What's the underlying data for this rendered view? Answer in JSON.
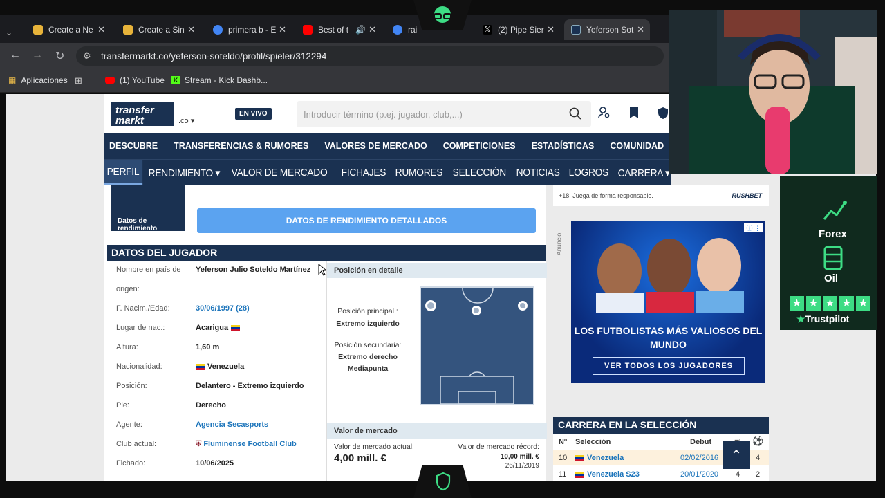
{
  "browser": {
    "tabs": [
      {
        "label": "Create a Ne",
        "fav": "#e7b33a"
      },
      {
        "label": "Create a Sin",
        "fav": "#e7b33a"
      },
      {
        "label": "primera b - E",
        "fav": "#4285f4"
      },
      {
        "label": "Best of t",
        "fav": "#ff0000"
      },
      {
        "label": "rai",
        "fav": "#4285f4"
      },
      {
        "label": "(2) Pipe Sier",
        "fav": "#000000"
      },
      {
        "label": "Yeferson Sot",
        "fav": "#1a3151"
      }
    ],
    "url": "transfermarkt.co/yeferson-soteldo/profil/spieler/312294",
    "bookmarks": [
      "Aplicaciones",
      "(1) YouTube",
      "Stream - Kick Dashb..."
    ]
  },
  "site": {
    "logo": "transfer markt",
    "logo_suffix": ".co",
    "live_badge": "EN VIVO",
    "search_placeholder": "Introducir término (p.ej. jugador, club,...)"
  },
  "main_nav": [
    "DESCUBRE",
    "TRANSFERENCIAS & RUMORES",
    "VALORES DE MERCADO",
    "COMPETICIONES",
    "ESTADÍSTICAS",
    "COMUNIDAD"
  ],
  "sub_nav": [
    "PERFIL",
    "RENDIMIENTO ▾",
    "VALOR DE MERCADO",
    "FICHAJES",
    "RUMORES",
    "SELECCIÓN",
    "NOTICIAS",
    "LOGROS",
    "CARRERA ▾"
  ],
  "performance": {
    "box_label": "Datos de rendimiento",
    "button": "DATOS DE RENDIMIENTO DETALLADOS"
  },
  "player": {
    "section_title": "DATOS DEL JUGADOR",
    "rows": [
      {
        "label": "Nombre en país de",
        "value": "Yeferson Julio Soteldo Martínez",
        "link": false,
        "flag": false
      },
      {
        "label": "origen:",
        "value": "",
        "link": false,
        "flag": false
      },
      {
        "label": "F. Nacim./Edad:",
        "value": "30/06/1997 (28)",
        "link": true,
        "flag": false
      },
      {
        "label": "Lugar de nac.:",
        "value": "Acarigua",
        "link": false,
        "flag": "after"
      },
      {
        "label": "Altura:",
        "value": "1,60 m",
        "link": false,
        "flag": false
      },
      {
        "label": "Nacionalidad:",
        "value": "Venezuela",
        "link": false,
        "flag": "before"
      },
      {
        "label": "Posición:",
        "value": "Delantero - Extremo izquierdo",
        "link": false,
        "flag": false
      },
      {
        "label": "Pie:",
        "value": "Derecho",
        "link": false,
        "flag": false
      },
      {
        "label": "Agente:",
        "value": "Agencia Secasports",
        "link": true,
        "flag": false
      },
      {
        "label": "Club actual:",
        "value": "Fluminense Football Club",
        "link": true,
        "flag": false
      },
      {
        "label": "Fichado:",
        "value": "10/06/2025",
        "link": false,
        "flag": false
      }
    ]
  },
  "position": {
    "title": "Posición en detalle",
    "main_label": "Posición principal :",
    "main_value": "Extremo izquierdo",
    "secondary_label": "Posición secundaria:",
    "secondary_values": [
      "Extremo derecho",
      "Mediapunta"
    ]
  },
  "market_value": {
    "title": "Valor de mercado",
    "current_label": "Valor de mercado actual:",
    "current_value": "4,00 mill. €",
    "record_label": "Valor de mercado récord:",
    "record_value": "10,00 mill. €",
    "record_date": "26/11/2019"
  },
  "sidebar": {
    "responsible": "+18. Juega de forma responsable.",
    "sponsor": "RUSHBET",
    "ad_label": "Anuncio",
    "ad_title": "LOS FUTBOLISTAS MÁS VALIOSOS DEL MUNDO",
    "ad_button": "VER TODOS LOS JUGADORES",
    "national_title": "CARRERA EN LA SELECCIÓN",
    "national_headers": [
      "Nº",
      "Selección",
      "Debut"
    ],
    "national_rows": [
      {
        "num": "10",
        "team": "Venezuela",
        "debut": "02/02/2016",
        "apps": "",
        "goals": "4"
      },
      {
        "num": "11",
        "team": "Venezuela S23",
        "debut": "20/01/2020",
        "apps": "4",
        "goals": "2"
      }
    ]
  },
  "overlay": {
    "forex": [
      "Forex",
      "Oil"
    ],
    "trustpilot": "Trustpilot"
  }
}
